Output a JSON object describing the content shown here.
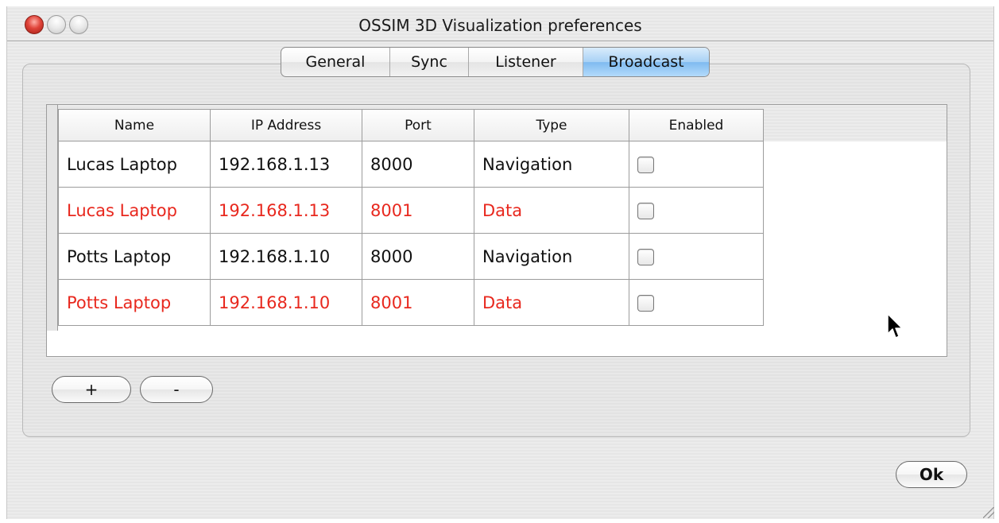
{
  "window": {
    "title": "OSSIM 3D Visualization preferences"
  },
  "tabs": [
    {
      "label": "General",
      "active": false
    },
    {
      "label": "Sync",
      "active": false
    },
    {
      "label": "Listener",
      "active": false
    },
    {
      "label": "Broadcast",
      "active": true
    }
  ],
  "table": {
    "columns": [
      "Name",
      "IP Address",
      "Port",
      "Type",
      "Enabled"
    ],
    "rows": [
      {
        "name": "Lucas Laptop",
        "ip": "192.168.1.13",
        "port": "8000",
        "type": "Navigation",
        "enabled": false,
        "color": "#111111"
      },
      {
        "name": "Lucas Laptop",
        "ip": "192.168.1.13",
        "port": "8001",
        "type": "Data",
        "enabled": false,
        "color": "#e8281e"
      },
      {
        "name": "Potts Laptop",
        "ip": "192.168.1.10",
        "port": "8000",
        "type": "Navigation",
        "enabled": false,
        "color": "#111111"
      },
      {
        "name": "Potts Laptop",
        "ip": "192.168.1.10",
        "port": "8001",
        "type": "Data",
        "enabled": false,
        "color": "#e8281e"
      }
    ]
  },
  "buttons": {
    "add_label": "+",
    "remove_label": "-",
    "ok_label": "Ok"
  },
  "colors": {
    "active_tab": "#a8d1f5",
    "red_row_text": "#e8281e"
  }
}
